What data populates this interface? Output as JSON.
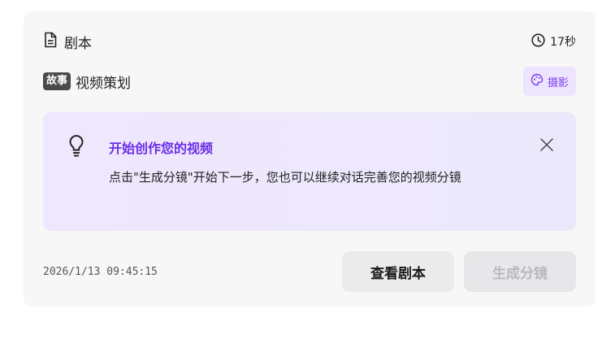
{
  "card": {
    "title": "剧本",
    "title_icon": "document-icon",
    "duration": "17秒",
    "duration_icon": "clock-icon",
    "tag": "故事",
    "subtitle": "视频策划",
    "style_chip": {
      "label": "摄影",
      "icon": "palette-icon"
    }
  },
  "notice": {
    "icon": "lightbulb-icon",
    "title": "开始创作您的视频",
    "body": "点击\"生成分镜\"开始下一步，您也可以继续对话完善您的视频分镜",
    "close_icon": "close-icon"
  },
  "footer": {
    "timestamp": "2026/1/13 09:45:15",
    "view_label": "查看剧本",
    "generate_label": "生成分镜"
  },
  "colors": {
    "accent": "#6b2ee8",
    "chip_bg": "#ede4fd",
    "card_bg": "#f7f7f8"
  }
}
